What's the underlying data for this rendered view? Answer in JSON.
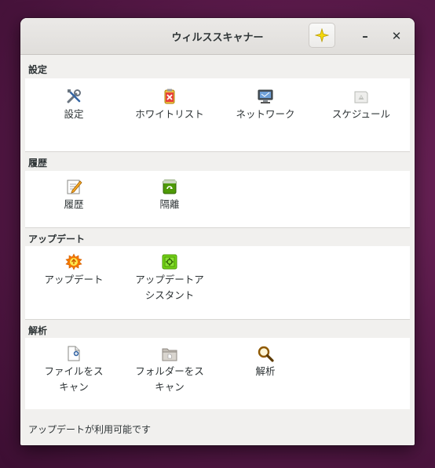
{
  "window": {
    "title": "ウィルススキャナー",
    "star_icon": "star-sparkle-icon",
    "minimize_label": "–",
    "close_label": "✕"
  },
  "sections": [
    {
      "header": "設定",
      "items": [
        {
          "label": "設定",
          "icon": "tools-icon"
        },
        {
          "label": "ホワイトリスト",
          "icon": "whitelist-icon"
        },
        {
          "label": "ネットワーク",
          "icon": "network-icon"
        },
        {
          "label": "スケジュール",
          "icon": "schedule-icon"
        }
      ]
    },
    {
      "header": "履歴",
      "items": [
        {
          "label": "履歴",
          "icon": "history-icon"
        },
        {
          "label": "隔離",
          "icon": "quarantine-icon"
        }
      ]
    },
    {
      "header": "アップデート",
      "items": [
        {
          "label": "アップデート",
          "icon": "update-icon"
        },
        {
          "label_line1": "アップデートア",
          "label_line2": "シスタント",
          "icon": "update-assistant-icon"
        }
      ]
    },
    {
      "header": "解析",
      "items": [
        {
          "label_line1": "ファイルをス",
          "label_line2": "キャン",
          "icon": "scan-file-icon"
        },
        {
          "label_line1": "フォルダーをス",
          "label_line2": "キャン",
          "icon": "scan-folder-icon"
        },
        {
          "label": "解析",
          "icon": "analysis-icon"
        }
      ]
    }
  ],
  "status": "アップデートが利用可能です",
  "colors": {
    "desktop": "#5a1a4a",
    "window_bg": "#f1f0ee",
    "panel_bg": "#ffffff",
    "text": "#2e3436"
  }
}
